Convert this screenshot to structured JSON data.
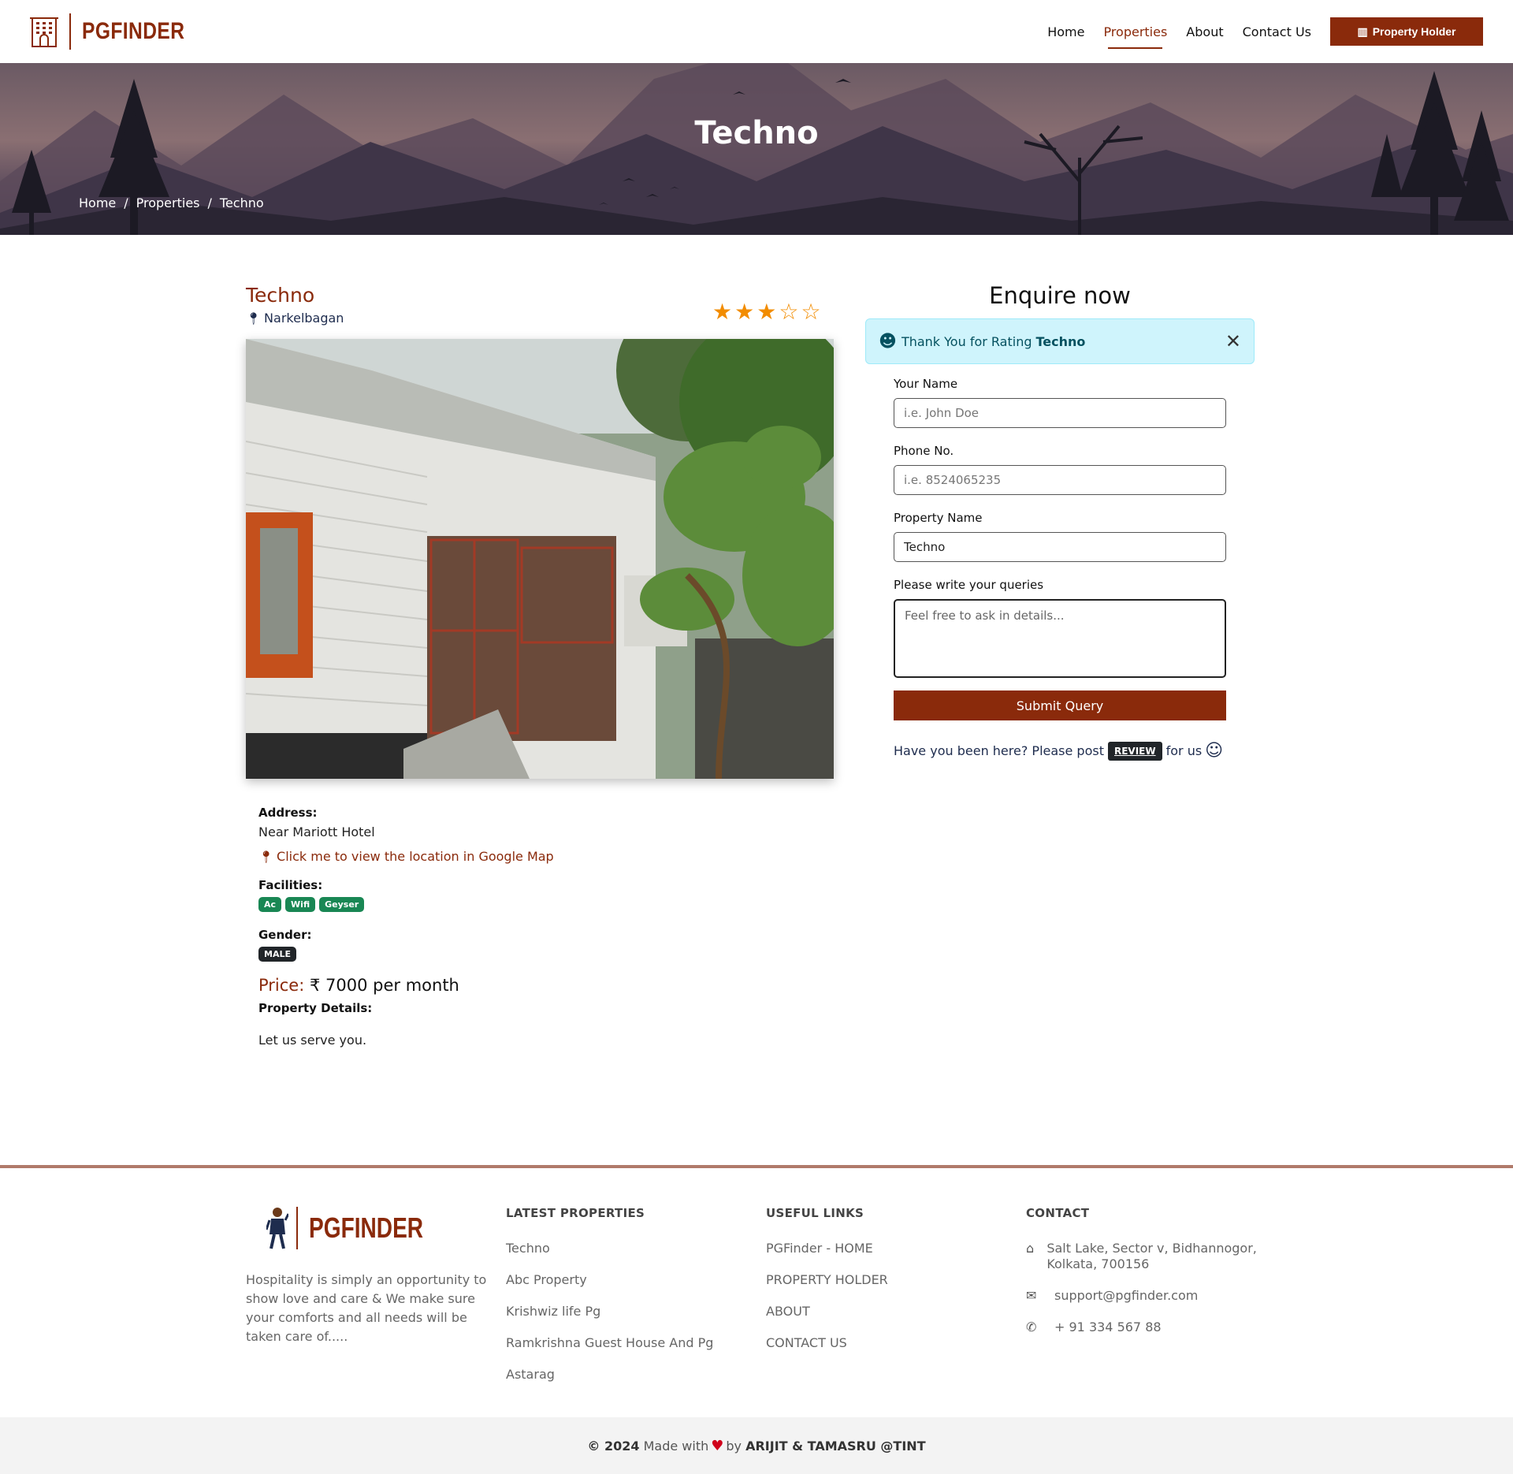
{
  "header": {
    "brand": "PGFINDER",
    "nav": [
      {
        "label": "Home",
        "active": false
      },
      {
        "label": "Properties",
        "active": true
      },
      {
        "label": "About",
        "active": false
      },
      {
        "label": "Contact Us",
        "active": false
      }
    ],
    "holder_button": "Property Holder"
  },
  "hero": {
    "title": "Techno",
    "breadcrumb": [
      "Home",
      "Properties",
      "Techno"
    ]
  },
  "property": {
    "name": "Techno",
    "location": "Narkelbagan",
    "rating": 3,
    "rating_max": 5,
    "address_label": "Address:",
    "address": "Near Mariott Hotel",
    "map_link": "Click me to view the location in Google Map",
    "facilities_label": "Facilities:",
    "facilities": [
      "Ac",
      "Wifi",
      "Geyser"
    ],
    "gender_label": "Gender:",
    "gender": "MALE",
    "price_label": "Price:",
    "price": "₹ 7000 per month",
    "details_label": "Property Details:",
    "details": "Let us serve you."
  },
  "enquiry": {
    "title": "Enquire now",
    "alert_text": "Thank You for Rating",
    "alert_name": "Techno",
    "name_label": "Your Name",
    "name_placeholder": "i.e. John Doe",
    "phone_label": "Phone No.",
    "phone_placeholder": "i.e. 8524065235",
    "property_label": "Property Name",
    "property_value": "Techno",
    "query_label": "Please write your queries",
    "query_placeholder": "Feel free to ask in details...",
    "submit_label": "Submit Query",
    "review_prefix": "Have you been here? Please post",
    "review_button": "REVIEW",
    "review_suffix": "for us"
  },
  "footer": {
    "brand": "PGFINDER",
    "about": "Hospitality is simply an opportunity to show love and care & We make sure your comforts and all needs will be taken care of.....",
    "latest_title": "LATEST PROPERTIES",
    "latest": [
      "Techno",
      "Abc Property",
      "Krishwiz life Pg",
      "Ramkrishna Guest House And Pg",
      "Astarag"
    ],
    "links_title": "USEFUL LINKS",
    "links": [
      "PGFinder - HOME",
      "PROPERTY HOLDER",
      "ABOUT",
      "CONTACT US"
    ],
    "contact_title": "CONTACT",
    "address": "Salt Lake, Sector v, Bidhannogor, Kolkata, 700156",
    "email": "support@pgfinder.com",
    "phone": "+ 91 334 567 88",
    "copy_year": "© 2024",
    "copy_made": "Made with",
    "copy_by": "by",
    "copy_authors": "ARIJIT & TAMASRU @TINT"
  },
  "colors": {
    "brand": "#8a2a0b",
    "star": "#f28c00",
    "facility_badge": "#198754",
    "alert_bg": "#cff4fc"
  }
}
